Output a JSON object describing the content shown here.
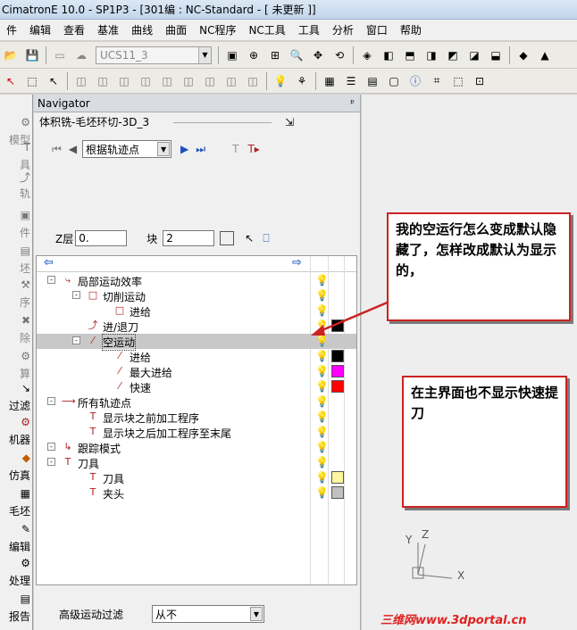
{
  "window": {
    "title": "CimatronE 10.0 - SP1P3 - [301编 : NC-Standard - [ 未更新 ]]"
  },
  "menu": [
    "件",
    "编辑",
    "查看",
    "基准",
    "曲线",
    "曲面",
    "NC程序",
    "NC工具",
    "工具",
    "分析",
    "窗口",
    "帮助"
  ],
  "toolbar": {
    "ucs_value": "UCS11_3"
  },
  "left_strip": [
    "模型",
    "具",
    "轨",
    "件",
    "坯",
    "序",
    "除",
    "算",
    "过滤",
    "机器",
    "仿真",
    "毛坯",
    "编辑",
    "处理",
    "报告"
  ],
  "navigator": {
    "panel_title": "Navigator",
    "pin": "ᵖ",
    "procedure_name": "体积铣-毛坯环切-3D_3",
    "step_mode": "根据轨迹点",
    "z_label": "Z层",
    "z_value": "0.",
    "block_label": "块",
    "block_value": "2",
    "tree": [
      {
        "label": "局部运动效率",
        "indent": 0,
        "exp": "-",
        "icon": "⤷",
        "sw": "",
        "bulb": "#f5e01a"
      },
      {
        "label": "切削运动",
        "indent": 1,
        "exp": "-",
        "icon": "□",
        "sw": "",
        "bulb": "#f5e01a"
      },
      {
        "label": "进给",
        "indent": 2,
        "exp": "",
        "icon": "□",
        "sw": "",
        "bulb": "#f5e01a"
      },
      {
        "label": "进/退刀",
        "indent": 1,
        "exp": "",
        "icon": "⤴",
        "sw": "#000000",
        "bulb": "#f5e01a"
      },
      {
        "label": "空运动",
        "indent": 1,
        "exp": "-",
        "icon": "⁄",
        "sw": "",
        "bulb": "#808080",
        "selected": true
      },
      {
        "label": "进给",
        "indent": 2,
        "exp": "",
        "icon": "⁄",
        "sw": "#000000",
        "bulb": "#808080"
      },
      {
        "label": "最大进给",
        "indent": 2,
        "exp": "",
        "icon": "⁄",
        "sw": "#ff00ff",
        "bulb": "#808080"
      },
      {
        "label": "快速",
        "indent": 2,
        "exp": "",
        "icon": "⁄",
        "sw": "#ff0000",
        "bulb": "#808080"
      },
      {
        "label": "所有轨迹点",
        "indent": 0,
        "exp": "-",
        "icon": "⟶",
        "sw": "",
        "bulb": "#f5e01a"
      },
      {
        "label": "显示块之前加工程序",
        "indent": 1,
        "exp": "",
        "icon": "T",
        "sw": "",
        "bulb": "#f5e01a"
      },
      {
        "label": "显示块之后加工程序至末尾",
        "indent": 1,
        "exp": "",
        "icon": "T",
        "sw": "",
        "bulb": "#f5e01a"
      },
      {
        "label": "跟踪模式",
        "indent": 0,
        "exp": "-",
        "icon": "↳",
        "sw": "",
        "bulb": "#f5e01a"
      },
      {
        "label": "刀具",
        "indent": 0,
        "exp": "-",
        "icon": "T",
        "sw": "",
        "bulb": "#f5e01a"
      },
      {
        "label": "刀具",
        "indent": 1,
        "exp": "",
        "icon": "T",
        "sw": "#fff6a0",
        "bulb": "#f5e01a"
      },
      {
        "label": "夹头",
        "indent": 1,
        "exp": "",
        "icon": "T",
        "sw": "#c0c0c0",
        "bulb": "#f5e01a"
      }
    ],
    "bottom_label": "高级运动过滤",
    "bottom_value": "从不"
  },
  "annotations": {
    "callout1": "我的空运行怎么变成默认隐藏了，怎样改成默认为显示的，",
    "callout2": "在主界面也不显示快速提刀"
  },
  "axes": {
    "y": "Y",
    "z": "Z",
    "x": "X"
  },
  "watermark": "三维网www.3dportal.cn"
}
